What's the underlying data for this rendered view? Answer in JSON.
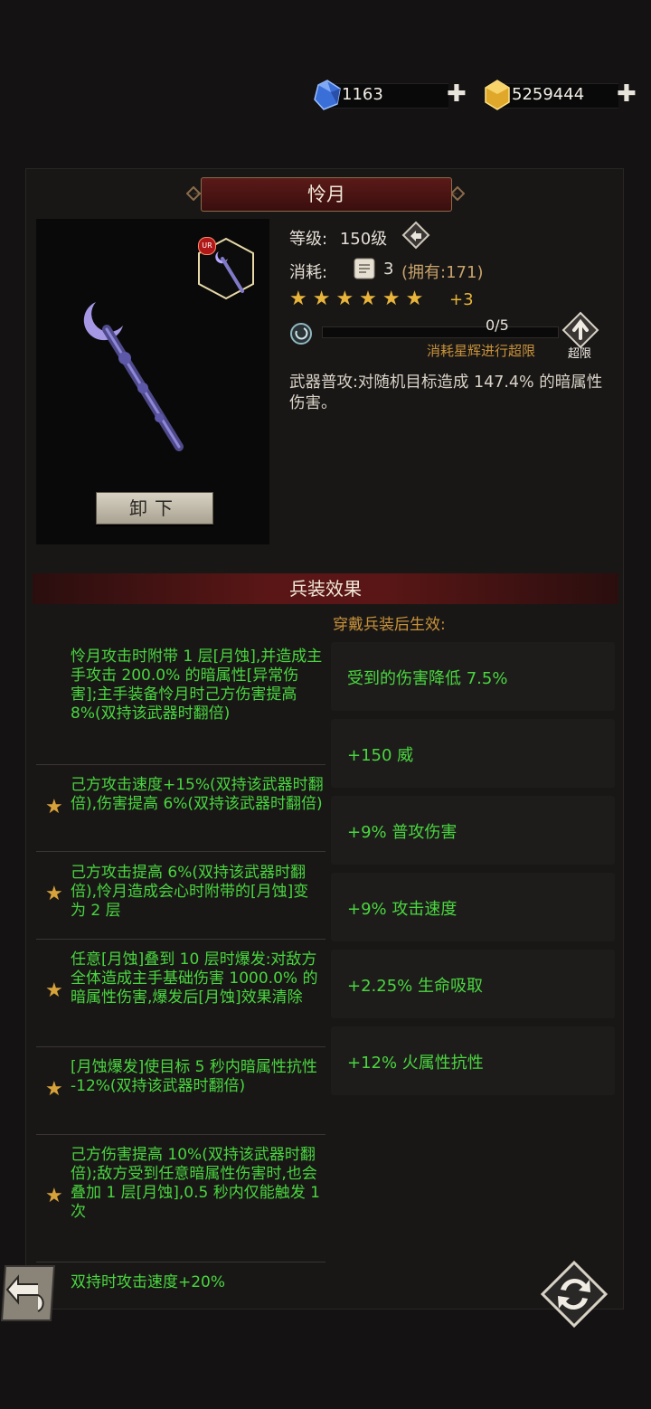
{
  "currency": {
    "gems": "1163",
    "gold": "5259444"
  },
  "weapon": {
    "name": "怜月",
    "level_label": "等级:",
    "level_value": "150级",
    "cost_label": "消耗:",
    "cost_count": "3",
    "owned_text": "(拥有:171)",
    "stars": "★★★★★★",
    "stars_plus": "+3",
    "progress_text": "0/5",
    "progress_fraction": 0,
    "progress_hint": "消耗星辉进行超限",
    "limit_break_label": "超限",
    "description": "武器普攻:对随机目标造成 147.4% 的暗属性伤害。",
    "rarity_badge": "UR",
    "unequip_label": "卸下"
  },
  "effects": {
    "header": "兵装效果",
    "equip_label": "穿戴兵装后生效:",
    "passives": [
      {
        "text": "怜月攻击时附带 1 层[月蚀],并造成主手攻击 200.0% 的暗属性[异常伤害];主手装备怜月时己方伤害提高 8%(双持该武器时翻倍)",
        "star": false
      },
      {
        "text": "己方攻击速度+15%(双持该武器时翻倍),伤害提高 6%(双持该武器时翻倍)",
        "star": true
      },
      {
        "text": "己方攻击提高 6%(双持该武器时翻倍),怜月造成会心时附带的[月蚀]变为 2 层",
        "star": true
      },
      {
        "text": "任意[月蚀]叠到 10 层时爆发:对敌方全体造成主手基础伤害 1000.0% 的暗属性伤害,爆发后[月蚀]效果清除",
        "star": true
      },
      {
        "text": "[月蚀爆发]使目标 5 秒内暗属性抗性 -12%(双持该武器时翻倍)",
        "star": true
      },
      {
        "text": "己方伤害提高 10%(双持该武器时翻倍);敌方受到任意暗属性伤害时,也会叠加 1 层[月蚀],0.5 秒内仅能触发 1 次",
        "star": true
      },
      {
        "text": "双持时攻击速度+20%",
        "star": false
      }
    ],
    "bonuses": [
      "受到的伤害降低 7.5%",
      "+150 威",
      "+9% 普攻伤害",
      "+9% 攻击速度",
      "+2.25% 生命吸取",
      "+12% 火属性抗性"
    ]
  },
  "colors": {
    "effect_green": "#49d63f",
    "accent_gold": "#c8923a",
    "banner_red": "#5a1a18"
  }
}
